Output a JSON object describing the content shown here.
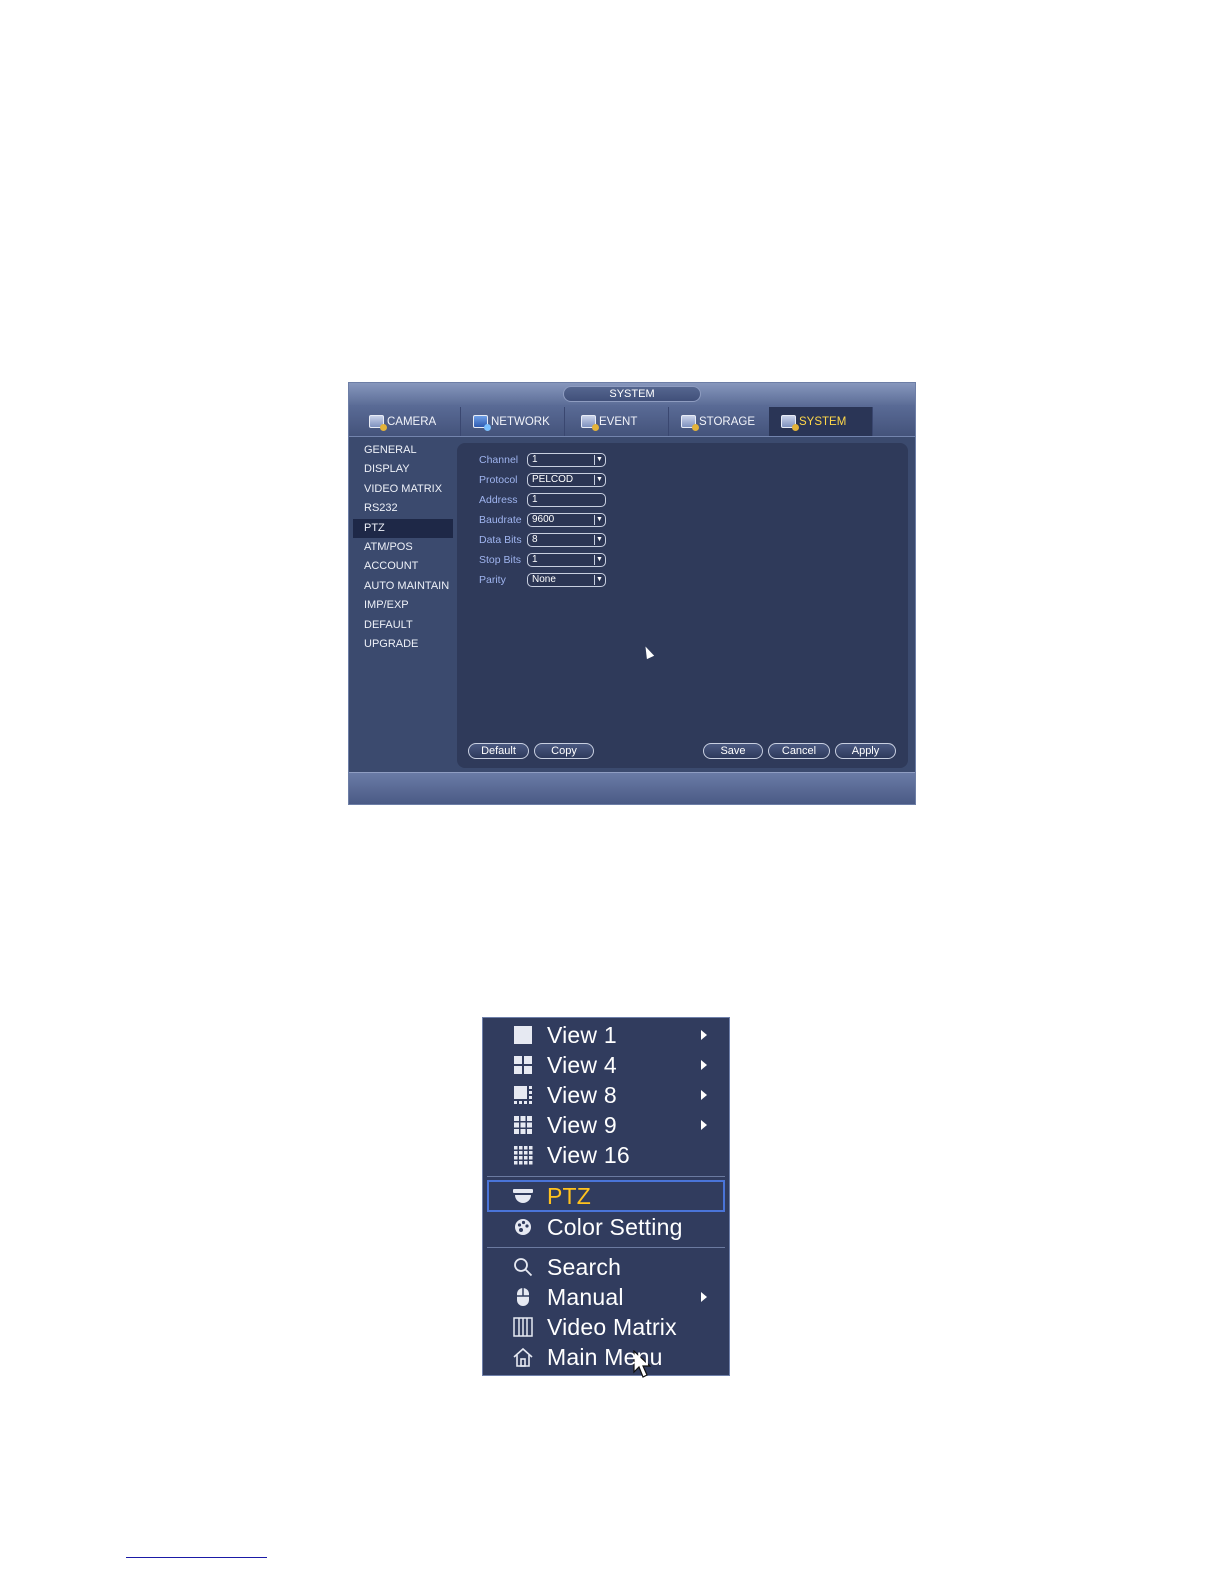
{
  "dvr": {
    "title": "SYSTEM",
    "tabs": [
      {
        "label": "CAMERA",
        "icon": "camera-settings-icon"
      },
      {
        "label": "NETWORK",
        "icon": "network-icon"
      },
      {
        "label": "EVENT",
        "icon": "event-icon"
      },
      {
        "label": "STORAGE",
        "icon": "storage-icon"
      },
      {
        "label": "SYSTEM",
        "icon": "system-icon"
      }
    ],
    "active_tab": "SYSTEM",
    "sidebar": [
      {
        "label": "GENERAL"
      },
      {
        "label": "DISPLAY"
      },
      {
        "label": "VIDEO MATRIX"
      },
      {
        "label": "RS232"
      },
      {
        "label": "PTZ"
      },
      {
        "label": "ATM/POS"
      },
      {
        "label": "ACCOUNT"
      },
      {
        "label": "AUTO MAINTAIN"
      },
      {
        "label": "IMP/EXP"
      },
      {
        "label": "DEFAULT"
      },
      {
        "label": "UPGRADE"
      }
    ],
    "active_sidebar": "PTZ",
    "fields": [
      {
        "label": "Channel",
        "value": "1"
      },
      {
        "label": "Protocol",
        "value": "PELCOD"
      },
      {
        "label": "Address",
        "value": "1"
      },
      {
        "label": "Baudrate",
        "value": "9600"
      },
      {
        "label": "Data Bits",
        "value": "8"
      },
      {
        "label": "Stop Bits",
        "value": "1"
      },
      {
        "label": "Parity",
        "value": "None"
      }
    ],
    "buttons": {
      "default": "Default",
      "copy": "Copy",
      "save": "Save",
      "cancel": "Cancel",
      "apply": "Apply"
    }
  },
  "context_menu": {
    "items": [
      {
        "label": "View 1",
        "icon": "view-1-icon"
      },
      {
        "label": "View 4",
        "icon": "view-4-icon"
      },
      {
        "label": "View 8",
        "icon": "view-8-icon"
      },
      {
        "label": "View 9",
        "icon": "view-9-icon"
      },
      {
        "label": "View 16",
        "icon": "view-16-icon"
      },
      {
        "label": "PTZ",
        "icon": "ptz-dome-icon"
      },
      {
        "label": "Color Setting",
        "icon": "palette-icon"
      },
      {
        "label": "Search",
        "icon": "search-icon"
      },
      {
        "label": "Manual",
        "icon": "mouse-icon"
      },
      {
        "label": "Video Matrix",
        "icon": "video-matrix-icon"
      },
      {
        "label": "Main Menu",
        "icon": "home-icon"
      }
    ],
    "highlighted": "PTZ"
  },
  "colors": {
    "window_bg": "#3b4a6e",
    "panel_bg": "#2f3a5a",
    "field_label": "#9fb4ef",
    "active_tab_text": "#ffd84a",
    "highlight_text": "#ffc21e",
    "highlight_border": "#4a74d8"
  }
}
